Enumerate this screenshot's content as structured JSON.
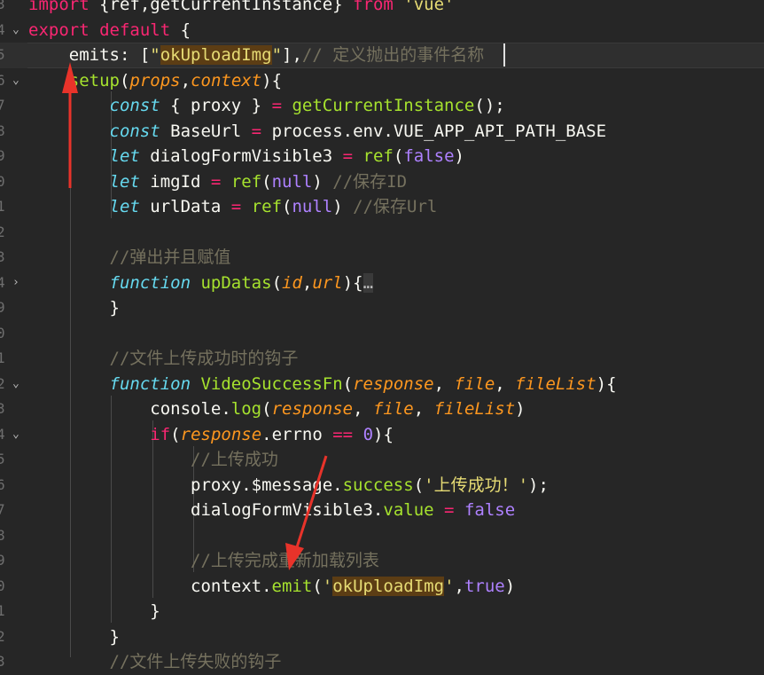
{
  "editor": {
    "lines": [
      {
        "num": "3",
        "fold": "",
        "tokens": [
          [
            "kw",
            "import"
          ],
          [
            "plain",
            " {ref,getCurrentInstance} "
          ],
          [
            "kw",
            "from"
          ],
          [
            "plain",
            " "
          ],
          [
            "str",
            "'vue'"
          ]
        ]
      },
      {
        "num": "4",
        "fold": "v",
        "tokens": [
          [
            "kw",
            "export"
          ],
          [
            "plain",
            " "
          ],
          [
            "kw",
            "default"
          ],
          [
            "plain",
            " {"
          ]
        ]
      },
      {
        "num": "5",
        "fold": "",
        "current": true,
        "tokens": [
          [
            "plain",
            "    emits: ["
          ],
          [
            "str",
            "\""
          ],
          [
            "strhl",
            "okUploadImg"
          ],
          [
            "str",
            "\""
          ],
          [
            "plain",
            "],"
          ],
          [
            "cmt",
            "// 定义抛出的事件名称"
          ]
        ]
      },
      {
        "num": "6",
        "fold": "v",
        "tokens": [
          [
            "plain",
            "    "
          ],
          [
            "fn",
            "setup"
          ],
          [
            "plain",
            "("
          ],
          [
            "param",
            "props"
          ],
          [
            "plain",
            ","
          ],
          [
            "param",
            "context"
          ],
          [
            "plain",
            "){"
          ]
        ]
      },
      {
        "num": "7",
        "fold": "",
        "tokens": [
          [
            "plain",
            "        "
          ],
          [
            "kw2",
            "const"
          ],
          [
            "plain",
            " { proxy } "
          ],
          [
            "kw",
            "="
          ],
          [
            "plain",
            " "
          ],
          [
            "fn",
            "getCurrentInstance"
          ],
          [
            "plain",
            "();"
          ]
        ]
      },
      {
        "num": "8",
        "fold": "",
        "tokens": [
          [
            "plain",
            "        "
          ],
          [
            "kw2",
            "const"
          ],
          [
            "plain",
            " BaseUrl "
          ],
          [
            "kw",
            "="
          ],
          [
            "plain",
            " process.env.VUE_APP_API_PATH_BASE"
          ]
        ]
      },
      {
        "num": "9",
        "fold": "",
        "tokens": [
          [
            "plain",
            "        "
          ],
          [
            "kw2",
            "let"
          ],
          [
            "plain",
            " dialogFormVisible3 "
          ],
          [
            "kw",
            "="
          ],
          [
            "plain",
            " "
          ],
          [
            "fn",
            "ref"
          ],
          [
            "plain",
            "("
          ],
          [
            "bool",
            "false"
          ],
          [
            "plain",
            ")"
          ]
        ]
      },
      {
        "num": "0",
        "fold": "",
        "tokens": [
          [
            "plain",
            "        "
          ],
          [
            "kw2",
            "let"
          ],
          [
            "plain",
            " imgId "
          ],
          [
            "kw",
            "="
          ],
          [
            "plain",
            " "
          ],
          [
            "fn",
            "ref"
          ],
          [
            "plain",
            "("
          ],
          [
            "bool",
            "null"
          ],
          [
            "plain",
            ") "
          ],
          [
            "cmt",
            "//保存ID"
          ]
        ]
      },
      {
        "num": "1",
        "fold": "",
        "tokens": [
          [
            "plain",
            "        "
          ],
          [
            "kw2",
            "let"
          ],
          [
            "plain",
            " urlData "
          ],
          [
            "kw",
            "="
          ],
          [
            "plain",
            " "
          ],
          [
            "fn",
            "ref"
          ],
          [
            "plain",
            "("
          ],
          [
            "bool",
            "null"
          ],
          [
            "plain",
            ") "
          ],
          [
            "cmt",
            "//保存Url"
          ]
        ]
      },
      {
        "num": "2",
        "fold": "",
        "tokens": []
      },
      {
        "num": "3",
        "fold": "",
        "tokens": [
          [
            "plain",
            "        "
          ],
          [
            "cmt",
            "//弹出并且赋值"
          ]
        ]
      },
      {
        "num": "4",
        "fold": ">",
        "tokens": [
          [
            "plain",
            "        "
          ],
          [
            "kw2",
            "function"
          ],
          [
            "plain",
            " "
          ],
          [
            "fn",
            "upDatas"
          ],
          [
            "plain",
            "("
          ],
          [
            "param",
            "id"
          ],
          [
            "plain",
            ","
          ],
          [
            "param",
            "url"
          ],
          [
            "plain",
            "){"
          ],
          [
            "ellipsis",
            "…"
          ]
        ]
      },
      {
        "num": "9",
        "fold": "",
        "tokens": [
          [
            "plain",
            "        }"
          ]
        ]
      },
      {
        "num": "0",
        "fold": "",
        "tokens": []
      },
      {
        "num": "1",
        "fold": "",
        "tokens": [
          [
            "plain",
            "        "
          ],
          [
            "cmt",
            "//文件上传成功时的钩子"
          ]
        ]
      },
      {
        "num": "2",
        "fold": "v",
        "tokens": [
          [
            "plain",
            "        "
          ],
          [
            "kw2",
            "function"
          ],
          [
            "plain",
            " "
          ],
          [
            "fn",
            "VideoSuccessFn"
          ],
          [
            "plain",
            "("
          ],
          [
            "param",
            "response"
          ],
          [
            "plain",
            ", "
          ],
          [
            "param",
            "file"
          ],
          [
            "plain",
            ", "
          ],
          [
            "param",
            "fileList"
          ],
          [
            "plain",
            "){"
          ]
        ]
      },
      {
        "num": "3",
        "fold": "",
        "tokens": [
          [
            "plain",
            "            console."
          ],
          [
            "fn",
            "log"
          ],
          [
            "plain",
            "("
          ],
          [
            "param",
            "response"
          ],
          [
            "plain",
            ", "
          ],
          [
            "param",
            "file"
          ],
          [
            "plain",
            ", "
          ],
          [
            "param",
            "fileList"
          ],
          [
            "plain",
            ")"
          ]
        ]
      },
      {
        "num": "4",
        "fold": "v",
        "tokens": [
          [
            "plain",
            "            "
          ],
          [
            "kw",
            "if"
          ],
          [
            "plain",
            "("
          ],
          [
            "param",
            "response"
          ],
          [
            "plain",
            ".errno "
          ],
          [
            "kw",
            "=="
          ],
          [
            "plain",
            " "
          ],
          [
            "bool",
            "0"
          ],
          [
            "plain",
            "){"
          ]
        ]
      },
      {
        "num": "5",
        "fold": "",
        "tokens": [
          [
            "plain",
            "                "
          ],
          [
            "cmt",
            "//上传成功"
          ]
        ]
      },
      {
        "num": "6",
        "fold": "",
        "tokens": [
          [
            "plain",
            "                proxy.$message."
          ],
          [
            "fn",
            "success"
          ],
          [
            "plain",
            "("
          ],
          [
            "str",
            "'上传成功！'"
          ],
          [
            "plain",
            ");"
          ]
        ]
      },
      {
        "num": "7",
        "fold": "",
        "tokens": [
          [
            "plain",
            "                dialogFormVisible3."
          ],
          [
            "fn",
            "value"
          ],
          [
            "plain",
            " "
          ],
          [
            "kw",
            "="
          ],
          [
            "plain",
            " "
          ],
          [
            "bool",
            "false"
          ]
        ]
      },
      {
        "num": "8",
        "fold": "",
        "tokens": []
      },
      {
        "num": "9",
        "fold": "",
        "tokens": [
          [
            "plain",
            "                "
          ],
          [
            "cmt",
            "//上传完成重新加载列表"
          ]
        ]
      },
      {
        "num": "0",
        "fold": "",
        "tokens": [
          [
            "plain",
            "                context."
          ],
          [
            "fn",
            "emit"
          ],
          [
            "plain",
            "("
          ],
          [
            "str",
            "'"
          ],
          [
            "strhl",
            "okUploadImg"
          ],
          [
            "str",
            "'"
          ],
          [
            "plain",
            ","
          ],
          [
            "bool",
            "true"
          ],
          [
            "plain",
            ")"
          ]
        ]
      },
      {
        "num": "1",
        "fold": "",
        "tokens": [
          [
            "plain",
            "            }"
          ]
        ]
      },
      {
        "num": "2",
        "fold": "",
        "tokens": [
          [
            "plain",
            "        }"
          ]
        ]
      },
      {
        "num": "3",
        "fold": "",
        "tokens": [
          [
            "plain",
            "        "
          ],
          [
            "cmt",
            "//文件上传失败的钩子"
          ]
        ]
      }
    ]
  },
  "colors": {
    "background": "#262626",
    "annotation_arrow": "#e8332a"
  }
}
